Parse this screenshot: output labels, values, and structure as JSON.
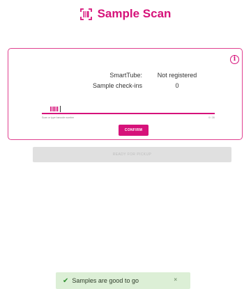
{
  "header": {
    "title": "Sample Scan",
    "icon": "barcode-scan-icon",
    "accent_color": "#d6127a"
  },
  "card": {
    "info_icon": "info-icon",
    "rows": [
      {
        "label": "SmartTube:",
        "value": "Not registered"
      },
      {
        "label": "Sample check-ins",
        "value": "0"
      }
    ],
    "input": {
      "value": "",
      "helper_text": "Scan or type barcode number",
      "counter": "0 / 30"
    },
    "confirm_label": "CONFIRM"
  },
  "pickup_button": {
    "label": "READY FOR PICKUP",
    "disabled": true
  },
  "toast": {
    "message": "Samples are good to go",
    "close_symbol": "×",
    "status_color": "#2e8f2e"
  }
}
